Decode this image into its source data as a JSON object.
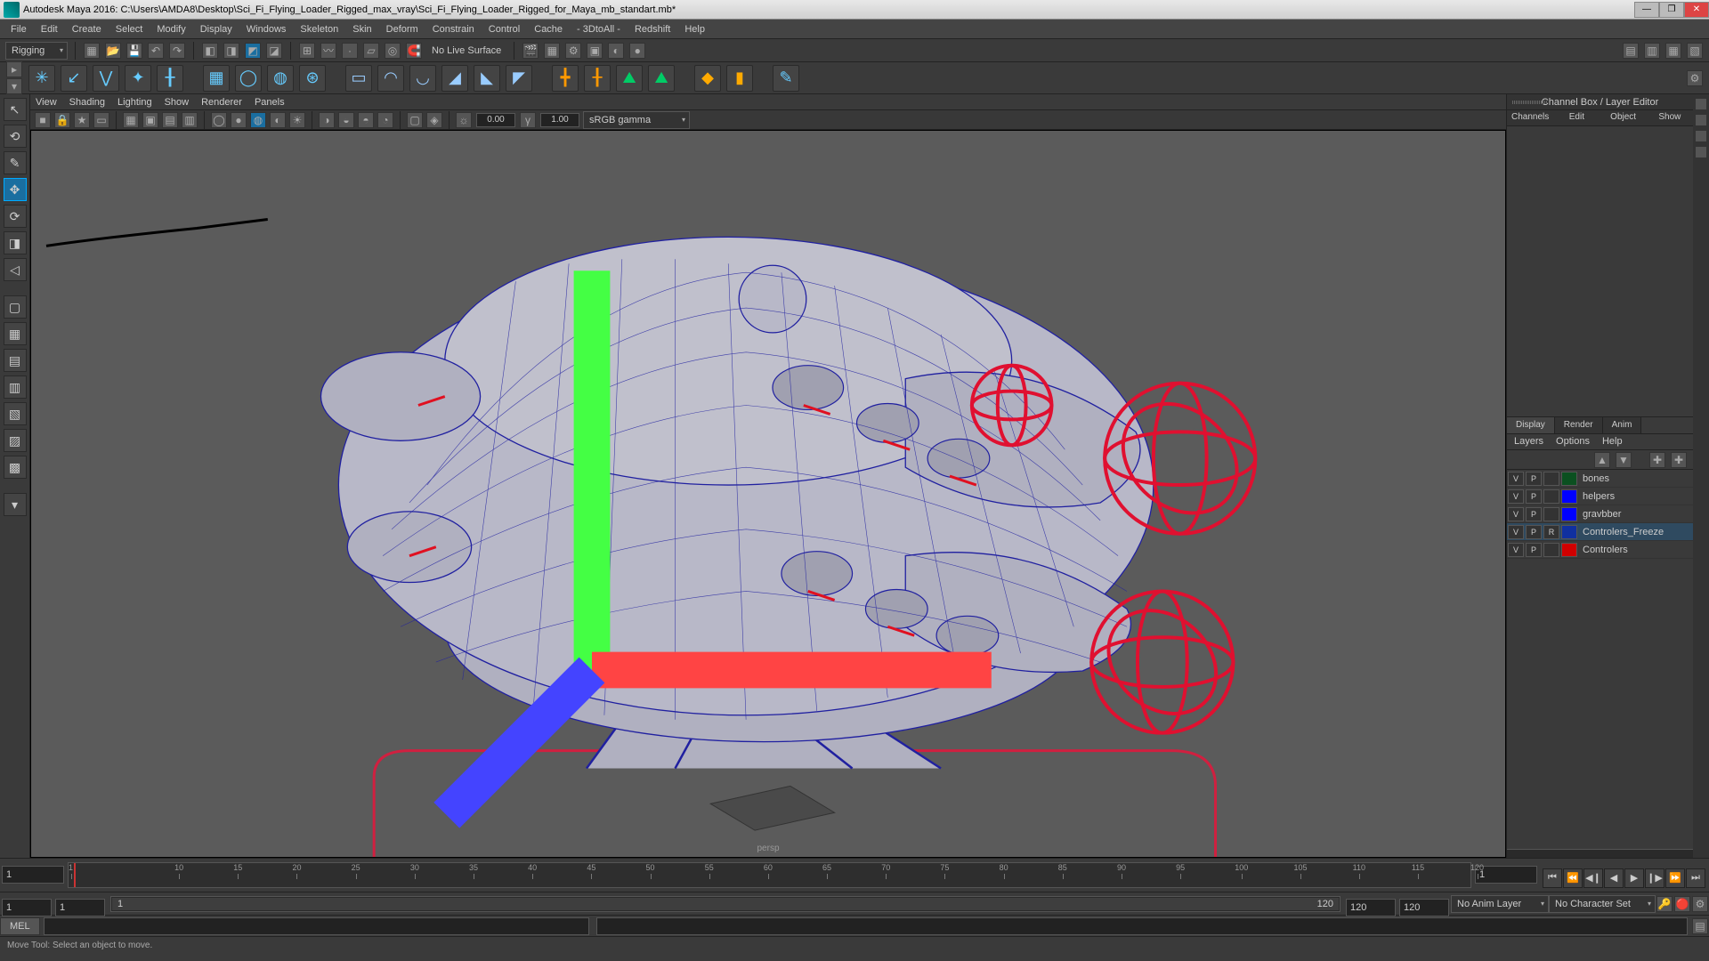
{
  "title": "Autodesk Maya 2016: C:\\Users\\AMDA8\\Desktop\\Sci_Fi_Flying_Loader_Rigged_max_vray\\Sci_Fi_Flying_Loader_Rigged_for_Maya_mb_standart.mb*",
  "menubar": [
    "File",
    "Edit",
    "Create",
    "Select",
    "Modify",
    "Display",
    "Windows",
    "Skeleton",
    "Skin",
    "Deform",
    "Constrain",
    "Control",
    "Cache",
    "- 3DtoAll -",
    "Redshift",
    "Help"
  ],
  "workspace": "Rigging",
  "status_text": "No Live Surface",
  "vp_menu": [
    "View",
    "Shading",
    "Lighting",
    "Show",
    "Renderer",
    "Panels"
  ],
  "vp_exposure": "0.00",
  "vp_gamma": "1.00",
  "vp_colorspace": "sRGB gamma",
  "viewport_camera": "persp",
  "channel_box_title": "Channel Box / Layer Editor",
  "channel_tabs": [
    "Channels",
    "Edit",
    "Object",
    "Show"
  ],
  "display_tabs": [
    "Display",
    "Render",
    "Anim"
  ],
  "layer_menu": [
    "Layers",
    "Options",
    "Help"
  ],
  "layers": [
    {
      "v": "V",
      "p": "P",
      "r": "",
      "color": "#0b5020",
      "name": "bones",
      "selected": false
    },
    {
      "v": "V",
      "p": "P",
      "r": "",
      "color": "#0000ff",
      "name": "helpers",
      "selected": false
    },
    {
      "v": "V",
      "p": "P",
      "r": "",
      "color": "#0000ff",
      "name": "gravbber",
      "selected": false
    },
    {
      "v": "V",
      "p": "P",
      "r": "R",
      "color": "#1030a0",
      "name": "Controlers_Freeze",
      "selected": true
    },
    {
      "v": "V",
      "p": "P",
      "r": "",
      "color": "#d00000",
      "name": "Controlers",
      "selected": false
    }
  ],
  "timeline": {
    "start": "1",
    "end": "120",
    "current": "1",
    "range_start": "1",
    "range_end": "120",
    "visible_start": "1",
    "visible_end": "120",
    "ticks": [
      1,
      10,
      15,
      20,
      25,
      30,
      35,
      40,
      45,
      50,
      55,
      60,
      65,
      70,
      75,
      80,
      85,
      90,
      95,
      100,
      105,
      110,
      115,
      120
    ]
  },
  "anim_layer": "No Anim Layer",
  "char_set": "No Character Set",
  "cmd_lang": "MEL",
  "help_line": "Move Tool: Select an object to move."
}
